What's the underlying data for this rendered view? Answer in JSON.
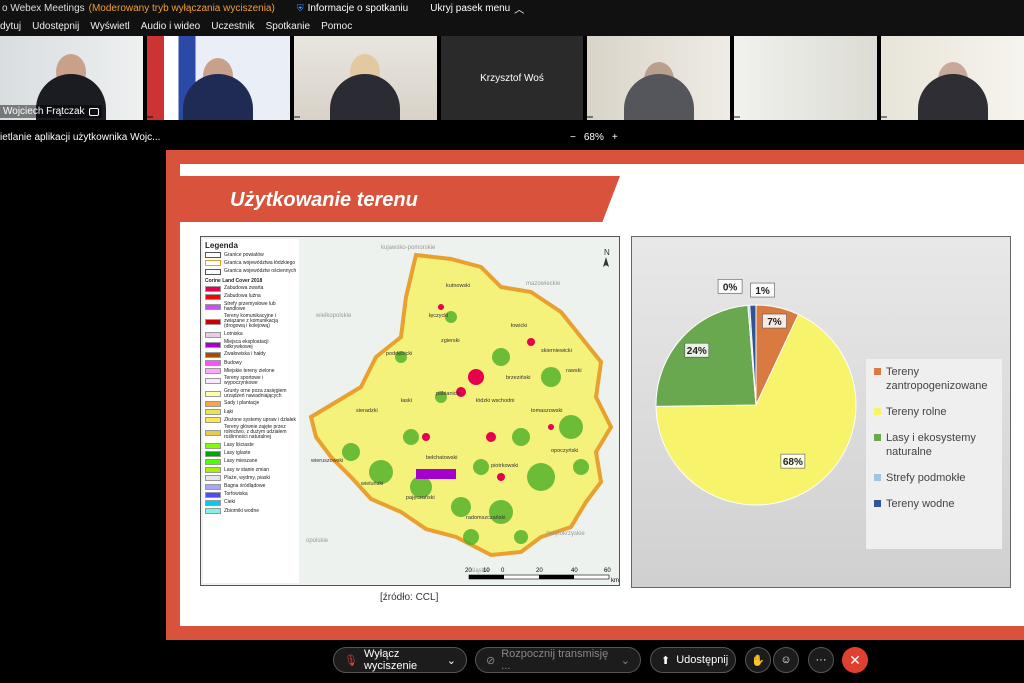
{
  "titlebar": {
    "app": "o Webex Meetings",
    "mode": "(Moderowany tryb wyłączania wyciszenia)",
    "info": "Informacje o spotkaniu",
    "hide": "Ukryj pasek menu"
  },
  "menu": [
    "dytuj",
    "Udostępnij",
    "Wyświetl",
    "Audio i wideo",
    "Uczestnik",
    "Spotkanie",
    "Pomoc"
  ],
  "tiles": [
    {
      "name": "Wojciech Frątczak"
    },
    {
      "name": ""
    },
    {
      "name": ""
    },
    {
      "name": "Krzysztof Woś"
    },
    {
      "name": ""
    },
    {
      "name": ""
    },
    {
      "name": ""
    }
  ],
  "share": {
    "label": "ietlanie aplikacji użytkownika Wojc...",
    "zoom_minus": "−",
    "zoom": "68%",
    "zoom_plus": "+"
  },
  "slide": {
    "title": "Użytkowanie terenu",
    "source": "[źródło: CCL]"
  },
  "map": {
    "legend_title": "Legenda",
    "legend_lines": [
      {
        "label": "Granice powiatów",
        "color": "#ffffff"
      },
      {
        "label": "Granica województwa łódzkiego",
        "color": "#e8a030"
      },
      {
        "label": "Granica województw ościennych",
        "color": "#ffffff"
      }
    ],
    "clc_title": "Corine Land Cover 2018",
    "legend_items": [
      {
        "label": "Zabudowa zwarta",
        "color": "#e6004d"
      },
      {
        "label": "Zabudowa luźna",
        "color": "#ff0000"
      },
      {
        "label": "Strefy przemysłowe lub handlowe",
        "color": "#cc4df2"
      },
      {
        "label": "Tereny komunikacyjne i związane z komunikacją (drogową i kolejową)",
        "color": "#cc0000"
      },
      {
        "label": "Lotniska",
        "color": "#e6cce6"
      },
      {
        "label": "Miejsca eksploatacji odkrywkowej",
        "color": "#a600cc"
      },
      {
        "label": "Zwałowiska i hałdy",
        "color": "#a64d00"
      },
      {
        "label": "Budowy",
        "color": "#ff4dff"
      },
      {
        "label": "Miejskie tereny zielone",
        "color": "#ffa6ff"
      },
      {
        "label": "Tereny sportowe i wypoczynkowe",
        "color": "#ffe6ff"
      },
      {
        "label": "Grunty orne poza zasięgiem urządzeń nawadniających",
        "color": "#ffffa8"
      },
      {
        "label": "Sady i plantacje",
        "color": "#f2a64d"
      },
      {
        "label": "Łąki",
        "color": "#e6e64d"
      },
      {
        "label": "Złożone systemy upraw i działek",
        "color": "#ffe64d"
      },
      {
        "label": "Tereny głównie zajęte przez rolnictwo, z dużym udziałem roślinności naturalnej",
        "color": "#e6cc4d"
      },
      {
        "label": "Lasy liściaste",
        "color": "#80ff00"
      },
      {
        "label": "Lasy iglaste",
        "color": "#00a600"
      },
      {
        "label": "Lasy mieszane",
        "color": "#4dff00"
      },
      {
        "label": "Lasy w stanie zmian",
        "color": "#a6f200"
      },
      {
        "label": "Plaże, wydmy, piaski",
        "color": "#e6e6e6"
      },
      {
        "label": "Bagna śródlądowe",
        "color": "#a6a6ff"
      },
      {
        "label": "Torfowiska",
        "color": "#4d4dff"
      },
      {
        "label": "Cieki",
        "color": "#00ccf2"
      },
      {
        "label": "Zbiorniki wodne",
        "color": "#80f2e6"
      }
    ],
    "neighbors": [
      "kujawsko-pomorskie",
      "mazowieckie",
      "wielkopolskie",
      "śląskie",
      "świętokrzyskie",
      "opolskie"
    ],
    "counties": [
      "kutnowski",
      "łęczycki",
      "łowicki",
      "zgierski",
      "skierniewicki",
      "poddębicki",
      "rawski",
      "brzeziński",
      "sieradzki",
      "łaski",
      "pabianicki",
      "łódzki wschodni",
      "tomaszowski",
      "piotrkowski",
      "opoczyński",
      "wieluński",
      "wieruszowski",
      "bełchatowski",
      "radomszczański",
      "pajęczański"
    ],
    "north": "N",
    "scale": [
      "20",
      "10",
      "0",
      "20",
      "40",
      "60"
    ],
    "scale_unit": "km"
  },
  "chart_data": {
    "type": "pie",
    "slices": [
      {
        "label": "Tereny zantropogenizowane",
        "value": 7,
        "color": "#d97b40"
      },
      {
        "label": "Tereny rolne",
        "value": 68,
        "color": "#f7f36a"
      },
      {
        "label": "Lasy i ekosystemy naturalne",
        "value": 24,
        "color": "#6aa84f"
      },
      {
        "label": "Strefy podmokłe",
        "value": 0,
        "color": "#9fc5e8"
      },
      {
        "label": "Tereny wodne",
        "value": 1,
        "color": "#2f5597"
      }
    ],
    "data_labels": [
      "7%",
      "68%",
      "24%",
      "0%",
      "1%"
    ],
    "legend_position": "right"
  },
  "controls": {
    "mute": "Wyłącz wyciszenie",
    "stream": "Rozpocznij transmisję ...",
    "share": "Udostępnij",
    "more": "···",
    "end": "✕"
  }
}
